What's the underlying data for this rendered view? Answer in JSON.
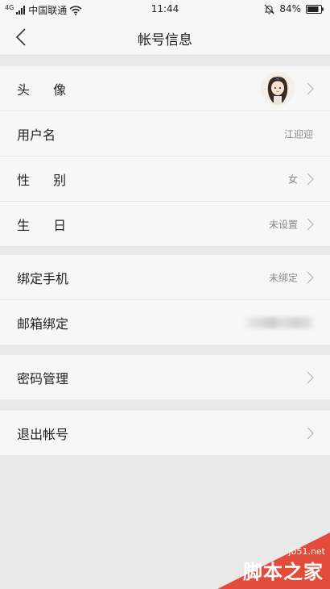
{
  "status_bar": {
    "network_type": "4G",
    "carrier": "中国联通",
    "time": "11:44",
    "battery": "84%"
  },
  "nav": {
    "title": "帐号信息"
  },
  "groups": [
    {
      "rows": [
        {
          "label": "头 像",
          "value": ""
        },
        {
          "label": "用户名",
          "value": "江迎迎"
        },
        {
          "label": "性 别",
          "value": "女"
        },
        {
          "label": "生 日",
          "value": "未设置"
        }
      ]
    },
    {
      "rows": [
        {
          "label": "绑定手机",
          "value": "未绑定"
        },
        {
          "label": "邮箱绑定",
          "value": ""
        }
      ]
    },
    {
      "rows": [
        {
          "label": "密码管理",
          "value": ""
        }
      ]
    },
    {
      "rows": [
        {
          "label": "退出帐号",
          "value": ""
        }
      ]
    }
  ],
  "watermark": {
    "site": "jb51.net",
    "name": "脚本之家"
  },
  "colors": {
    "background": "#e9e9e9",
    "panel": "#f7f7f7",
    "watermark_red": "#e24b3a"
  }
}
